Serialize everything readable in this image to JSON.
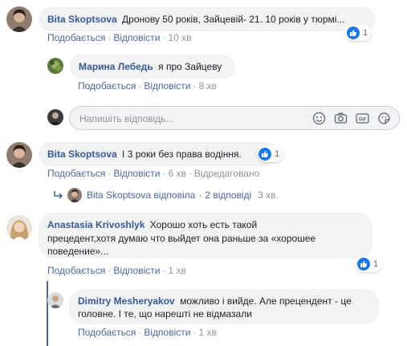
{
  "comments": [
    {
      "author": "Bita Skoptsova",
      "text": "Дронову 50 років, Зайцевій- 21. 10 років у тюрмі...",
      "like_label": "Подобається",
      "reply_label": "Відповісти",
      "time": "10 хв",
      "reaction_count": "1"
    },
    {
      "author": "Марина Лебедь",
      "text": "я про Зайцеву",
      "like_label": "Подобається",
      "reply_label": "Відповісти",
      "time": "8 хв"
    },
    {
      "author": "Bita Skoptsova",
      "text": "І 3 роки без права водіння.",
      "like_label": "Подобається",
      "reply_label": "Відповісти",
      "time": "6 хв",
      "edited_label": "Відредаговано",
      "reaction_count": "1"
    },
    {
      "author": "Anastasia Krivoshlyk",
      "text_line1": "Хорошо хоть есть такой",
      "text_line2": "прецедент,хотя думаю что выйдет она раньше за «хорошее",
      "text_line3": "поведение»...",
      "like_label": "Подобається",
      "reply_label": "Відповісти",
      "time": "1 хв",
      "reaction_count": "1"
    },
    {
      "author": "Dimitry Mesheryakov",
      "text_line1": "можливо і вийде. Але прецендент - це",
      "text_line2": "головне. І те, що нарешті не відмазали",
      "like_label": "Подобається",
      "reply_label": "Відповісти",
      "time": "1 хв"
    }
  ],
  "reply_input": {
    "placeholder": "Напишіть відповідь..."
  },
  "replies_summary": {
    "author_action": "Bita Skoptsova відповіла",
    "count": "2 відповіді",
    "time": "3 хв."
  },
  "colors": {
    "link": "#4b67a1",
    "author": "#385898",
    "bubble": "#f2f3f5",
    "like_blue": "#1877f2",
    "meta": "#90949c"
  },
  "icons": [
    "emoji-icon",
    "camera-icon",
    "gif-icon",
    "sticker-icon",
    "thumbs-up-icon",
    "reply-arrow-icon"
  ]
}
